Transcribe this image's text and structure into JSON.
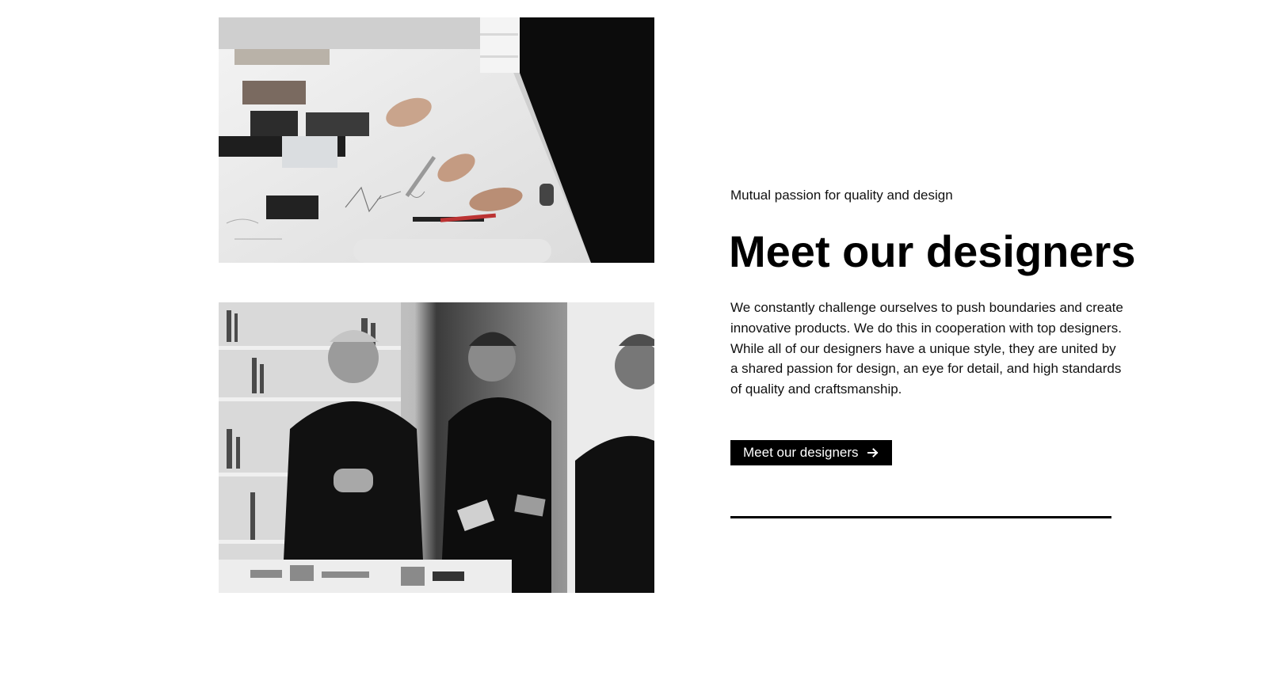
{
  "section": {
    "eyebrow": "Mutual passion for quality and design",
    "heading": "Meet our designers",
    "body": "We constantly challenge ourselves to push boundaries and create innovative products. We do this in cooperation with top designers. While all of our designers have a unique style, they are united by a shared passion for design, an eye for detail, and high standards of quality and crafts­manship.",
    "cta_label": "Meet our designers",
    "cta_icon": "arrow-right-icon"
  },
  "colors": {
    "background": "#ffffff",
    "text": "#000000",
    "button_bg": "#000000",
    "button_text": "#ffffff"
  }
}
